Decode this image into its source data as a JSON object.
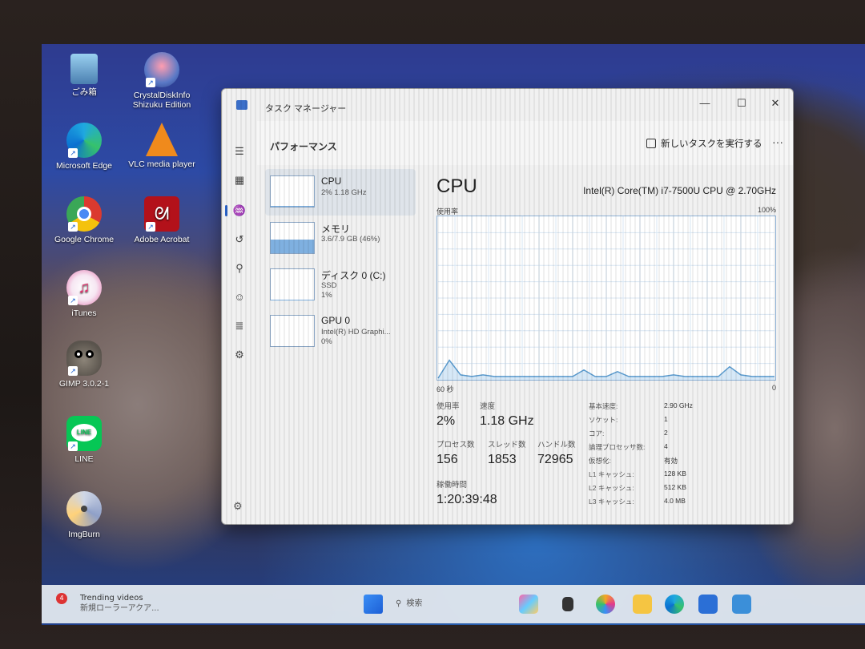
{
  "desktop": {
    "icons": [
      {
        "label": "ごみ箱",
        "icon": "recycle-bin-icon"
      },
      {
        "label": "CrystalDiskInfo Shizuku Edition",
        "icon": "crystaldiskinfo-icon"
      },
      {
        "label": "Microsoft Edge",
        "icon": "edge-icon"
      },
      {
        "label": "VLC media player",
        "icon": "vlc-icon"
      },
      {
        "label": "Google Chrome",
        "icon": "chrome-icon"
      },
      {
        "label": "Adobe Acrobat",
        "icon": "acrobat-icon"
      },
      {
        "label": "iTunes",
        "icon": "itunes-icon"
      },
      {
        "label": "GIMP 3.0.2-1",
        "icon": "gimp-icon"
      },
      {
        "label": "LINE",
        "icon": "line-icon"
      },
      {
        "label": "ImgBurn",
        "icon": "imgburn-icon"
      }
    ]
  },
  "task_manager": {
    "title": "タスク マネージャー",
    "window_controls": {
      "minimize": "—",
      "maximize": "☐",
      "close": "✕"
    },
    "page_title": "パフォーマンス",
    "new_task": "新しいタスクを実行する",
    "more": "···",
    "resources": [
      {
        "name": "CPU",
        "line1": "2%  1.18 GHz",
        "line2": "",
        "fill": 0.02
      },
      {
        "name": "メモリ",
        "line1": "3.6/7.9 GB (46%)",
        "line2": "",
        "fill": 0.46
      },
      {
        "name": "ディスク 0 (C:)",
        "line1": "SSD",
        "line2": "1%",
        "fill": 0.01
      },
      {
        "name": "GPU 0",
        "line1": "Intel(R) HD Graphi...",
        "line2": "0%",
        "fill": 0.0
      }
    ],
    "cpu": {
      "heading": "CPU",
      "model": "Intel(R) Core(TM) i7-7500U CPU @ 2.70GHz",
      "graph_label": "使用率",
      "graph_max": "100%",
      "graph_xleft": "60 秒",
      "graph_xright": "0",
      "usage_label": "使用率",
      "usage_value": "2%",
      "speed_label": "速度",
      "speed_value": "1.18 GHz",
      "processes_label": "プロセス数",
      "processes_value": "156",
      "threads_label": "スレッド数",
      "threads_value": "1853",
      "handles_label": "ハンドル数",
      "handles_value": "72965",
      "uptime_label": "稼働時間",
      "uptime_value": "1:20:39:48",
      "specs": [
        {
          "k": "基本速度:",
          "v": "2.90 GHz"
        },
        {
          "k": "ソケット:",
          "v": "1"
        },
        {
          "k": "コア:",
          "v": "2"
        },
        {
          "k": "論理プロセッサ数:",
          "v": "4"
        },
        {
          "k": "仮想化:",
          "v": "有効"
        },
        {
          "k": "L1 キャッシュ:",
          "v": "128 KB"
        },
        {
          "k": "L2 キャッシュ:",
          "v": "512 KB"
        },
        {
          "k": "L3 キャッシュ:",
          "v": "4.0 MB"
        }
      ]
    }
  },
  "taskbar": {
    "news_title": "Trending videos",
    "news_sub": "新規ローラーアクア...",
    "news_badge": "4",
    "search_placeholder": "検索"
  },
  "chart_data": {
    "type": "area",
    "title": "",
    "xlabel": "",
    "ylabel": "",
    "ylim": [
      0,
      100
    ],
    "x": [
      60,
      58,
      56,
      54,
      52,
      50,
      48,
      46,
      44,
      42,
      40,
      38,
      36,
      34,
      32,
      30,
      28,
      26,
      24,
      22,
      20,
      18,
      16,
      14,
      12,
      10,
      8,
      6,
      4,
      2,
      0
    ],
    "series": [
      {
        "values": [
          1,
          12,
          3,
          2,
          3,
          2,
          2,
          2,
          2,
          2,
          2,
          2,
          2,
          6,
          2,
          2,
          5,
          2,
          2,
          2,
          2,
          3,
          2,
          2,
          2,
          2,
          8,
          3,
          2,
          2,
          2
        ]
      }
    ]
  }
}
